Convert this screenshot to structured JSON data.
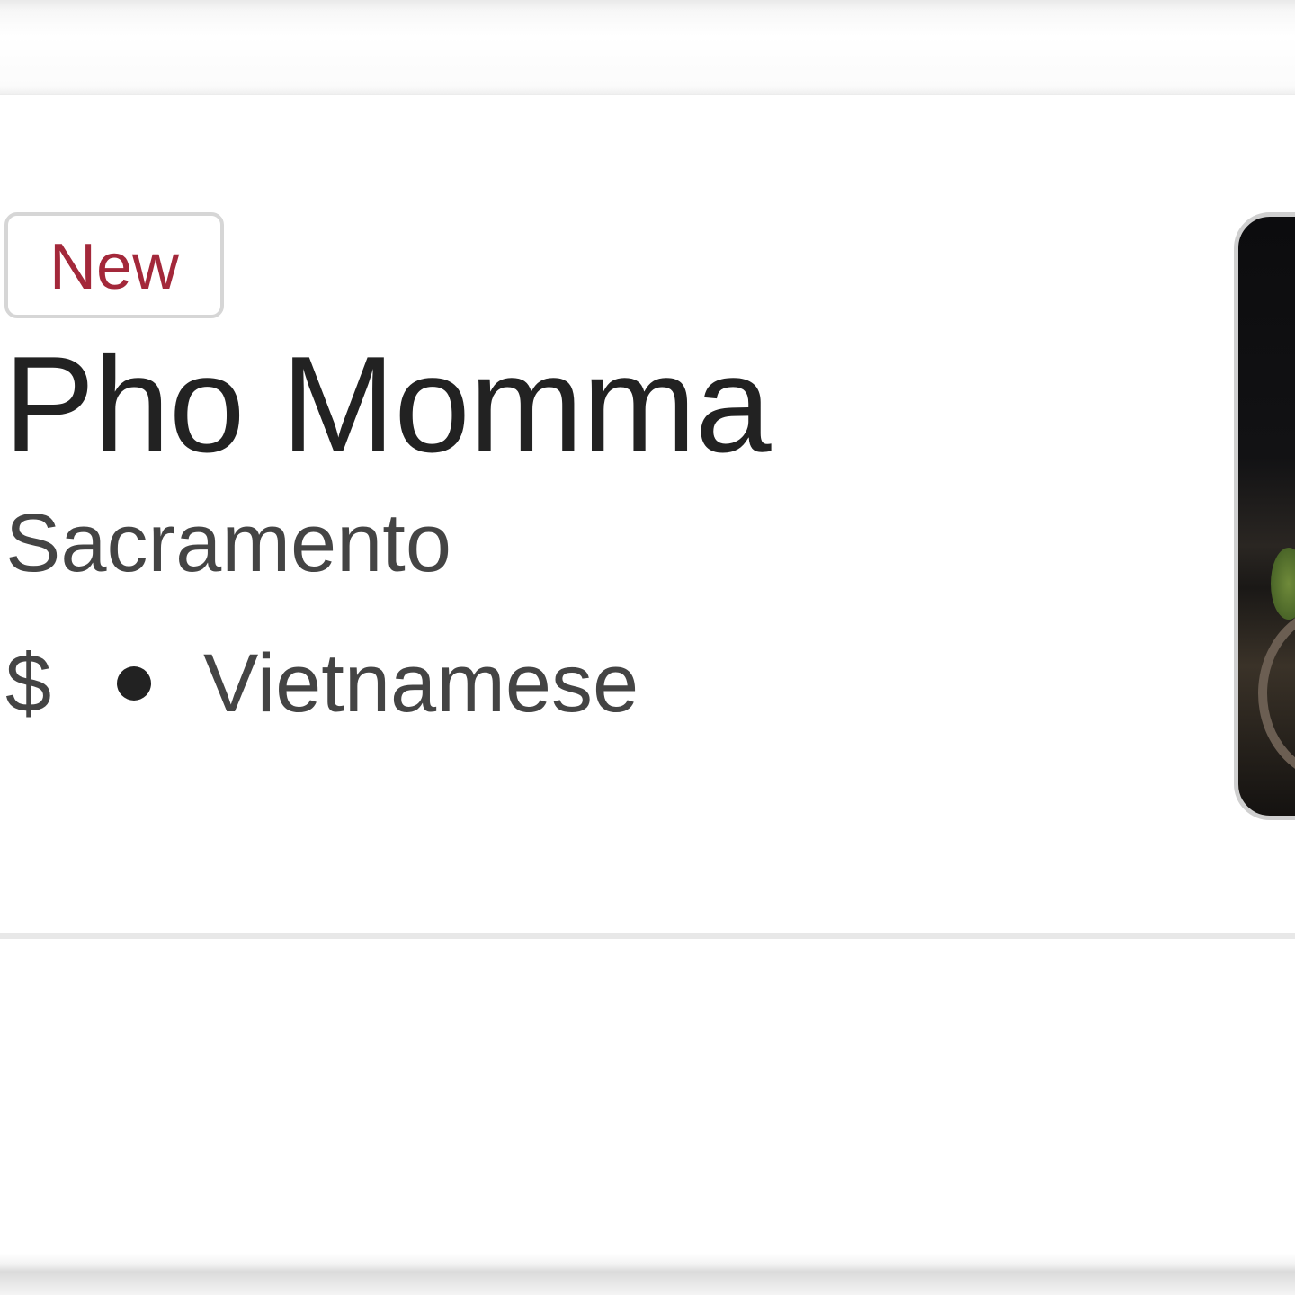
{
  "listing": {
    "badge": "New",
    "name": "Pho Momma",
    "city": "Sacramento",
    "price": "$",
    "cuisine": "Vietnamese",
    "image_icon": "food-photo"
  },
  "colors": {
    "badge_text": "#a3283a",
    "title_text": "#222222",
    "secondary_text": "#444444"
  }
}
